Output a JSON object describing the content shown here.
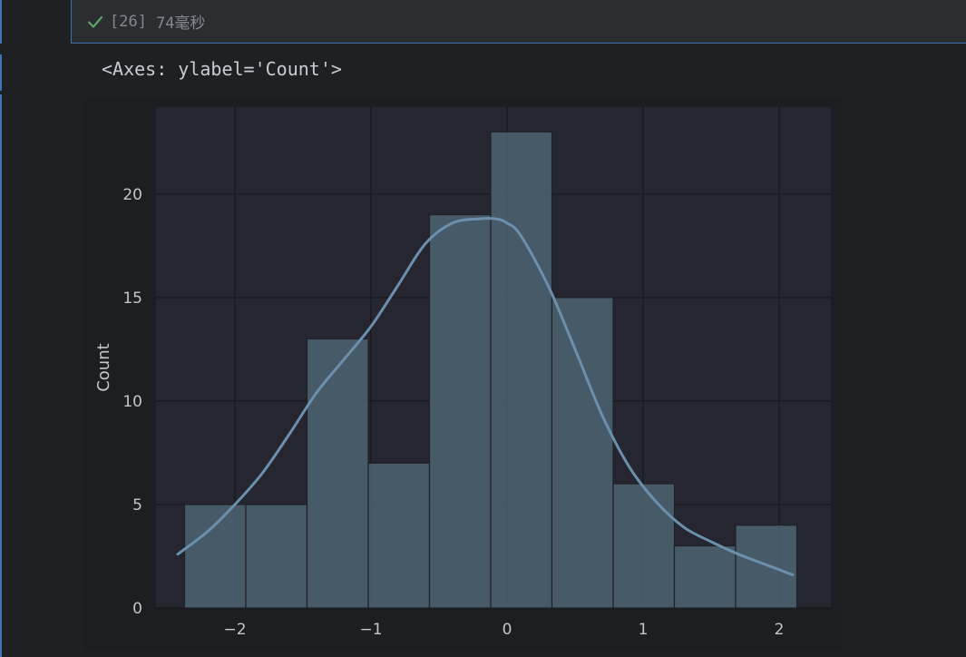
{
  "cell": {
    "execution_count": "[26]",
    "execution_time": "74毫秒",
    "status": "success",
    "output_text": "<Axes: ylabel='Count'>"
  },
  "colors": {
    "page_background": "#1f2024",
    "plot_background": "#25262f",
    "bar_fill": "#4a5e6e",
    "kde_line": "#6a90ad",
    "success_check": "#5aa46a"
  },
  "chart_data": {
    "type": "bar",
    "subtype": "histogram with kde",
    "title": "",
    "xlabel": "",
    "ylabel": "Count",
    "xlim": [
      -2.58,
      2.38
    ],
    "ylim": [
      0,
      24.2
    ],
    "xticks": [
      -2,
      -1,
      0,
      1,
      2
    ],
    "xtick_labels": [
      "−2",
      "−1",
      "0",
      "1",
      "2"
    ],
    "yticks": [
      0,
      5,
      10,
      15,
      20
    ],
    "ytick_labels": [
      "0",
      "5",
      "10",
      "15",
      "20"
    ],
    "grid": true,
    "bins": [
      {
        "x0": -2.37,
        "x1": -1.92,
        "count": 5
      },
      {
        "x0": -1.92,
        "x1": -1.47,
        "count": 5
      },
      {
        "x0": -1.47,
        "x1": -1.02,
        "count": 13
      },
      {
        "x0": -1.02,
        "x1": -0.57,
        "count": 7
      },
      {
        "x0": -0.57,
        "x1": -0.12,
        "count": 19
      },
      {
        "x0": -0.12,
        "x1": 0.33,
        "count": 23
      },
      {
        "x0": 0.33,
        "x1": 0.78,
        "count": 15
      },
      {
        "x0": 0.78,
        "x1": 1.23,
        "count": 6
      },
      {
        "x0": 1.23,
        "x1": 1.68,
        "count": 3
      },
      {
        "x0": 1.68,
        "x1": 2.13,
        "count": 4
      }
    ],
    "kde": {
      "x": [
        -2.42,
        -2.2,
        -2.0,
        -1.8,
        -1.6,
        -1.4,
        -1.2,
        -1.0,
        -0.8,
        -0.6,
        -0.4,
        -0.2,
        -0.08,
        0.0,
        0.1,
        0.3,
        0.5,
        0.7,
        0.9,
        1.1,
        1.3,
        1.5,
        1.7,
        1.9,
        2.1
      ],
      "y": [
        2.6,
        3.7,
        5.0,
        6.5,
        8.4,
        10.4,
        12.0,
        13.6,
        15.6,
        17.6,
        18.6,
        18.8,
        18.8,
        18.6,
        18.0,
        15.6,
        12.5,
        9.3,
        6.8,
        5.1,
        3.9,
        3.2,
        2.6,
        2.1,
        1.6
      ]
    }
  }
}
